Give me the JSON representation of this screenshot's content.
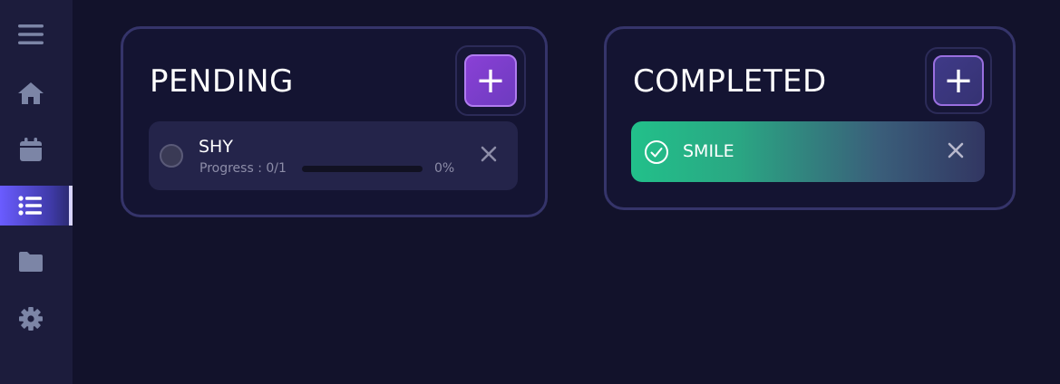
{
  "sidebar": {
    "items": [
      {
        "icon": "menu-icon",
        "active": false
      },
      {
        "icon": "home-icon",
        "active": false
      },
      {
        "icon": "calendar-icon",
        "active": false
      },
      {
        "icon": "list-icon",
        "active": true
      },
      {
        "icon": "folder-icon",
        "active": false
      },
      {
        "icon": "gear-icon",
        "active": false
      }
    ]
  },
  "pending": {
    "title": "PENDING",
    "add_label": "+",
    "tasks": [
      {
        "name": "SHY",
        "progress_label": "Progress : 0/1",
        "progress_fraction": 0,
        "percent": "0%"
      }
    ]
  },
  "completed": {
    "title": "COMPLETED",
    "add_label": "+",
    "tasks": [
      {
        "name": "SMILE"
      }
    ]
  },
  "colors": {
    "background": "#12122b",
    "sidebar": "#1c1c3c",
    "accent": "#6a5cff",
    "complete_green": "#22c08a",
    "add_purple": "#8a40d6"
  }
}
